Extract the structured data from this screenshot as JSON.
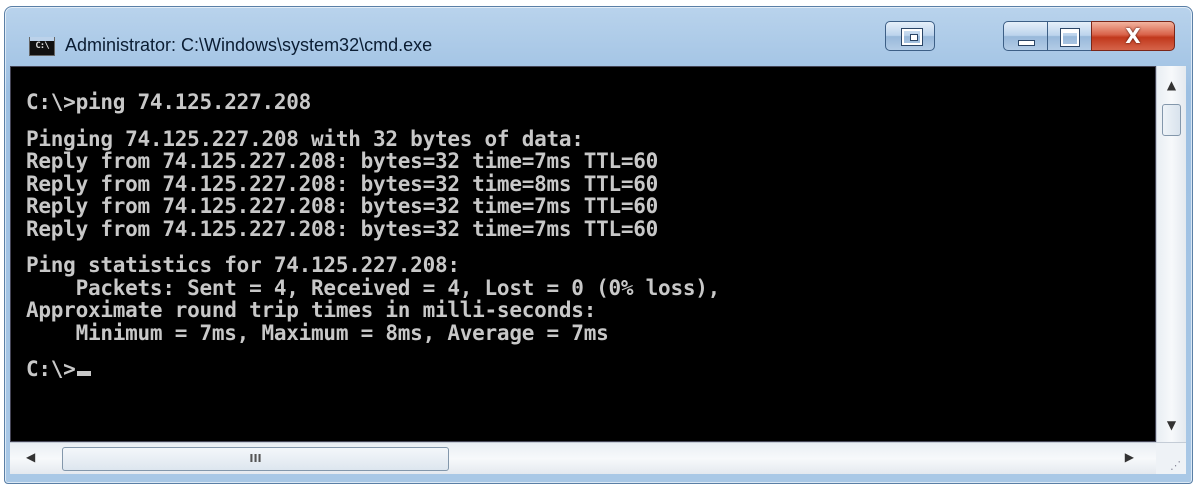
{
  "window": {
    "title": "Administrator: C:\\Windows\\system32\\cmd.exe",
    "icon": "cmd-app-icon",
    "icon_text": "C:\\",
    "controls": {
      "restore_icon": "window-switch-icon",
      "minimize_icon": "minimize-icon",
      "maximize_icon": "maximize-icon",
      "close_icon": "close-icon",
      "close_glyph": "X"
    }
  },
  "console": {
    "lines": [
      "C:\\>ping 74.125.227.208",
      "",
      "Pinging 74.125.227.208 with 32 bytes of data:",
      "Reply from 74.125.227.208: bytes=32 time=7ms TTL=60",
      "Reply from 74.125.227.208: bytes=32 time=8ms TTL=60",
      "Reply from 74.125.227.208: bytes=32 time=7ms TTL=60",
      "Reply from 74.125.227.208: bytes=32 time=7ms TTL=60",
      "",
      "Ping statistics for 74.125.227.208:",
      "    Packets: Sent = 4, Received = 4, Lost = 0 (0% loss),",
      "Approximate round trip times in milli-seconds:",
      "    Minimum = 7ms, Maximum = 8ms, Average = 7ms",
      "",
      "C:\\>"
    ],
    "colors": {
      "background": "#000000",
      "text": "#c8c8c8"
    }
  },
  "scrollbars": {
    "vertical": {
      "up_arrow": "▲",
      "down_arrow": "▼"
    },
    "horizontal": {
      "left_arrow": "◀",
      "right_arrow": "▶",
      "thumb_grip": "III"
    }
  }
}
